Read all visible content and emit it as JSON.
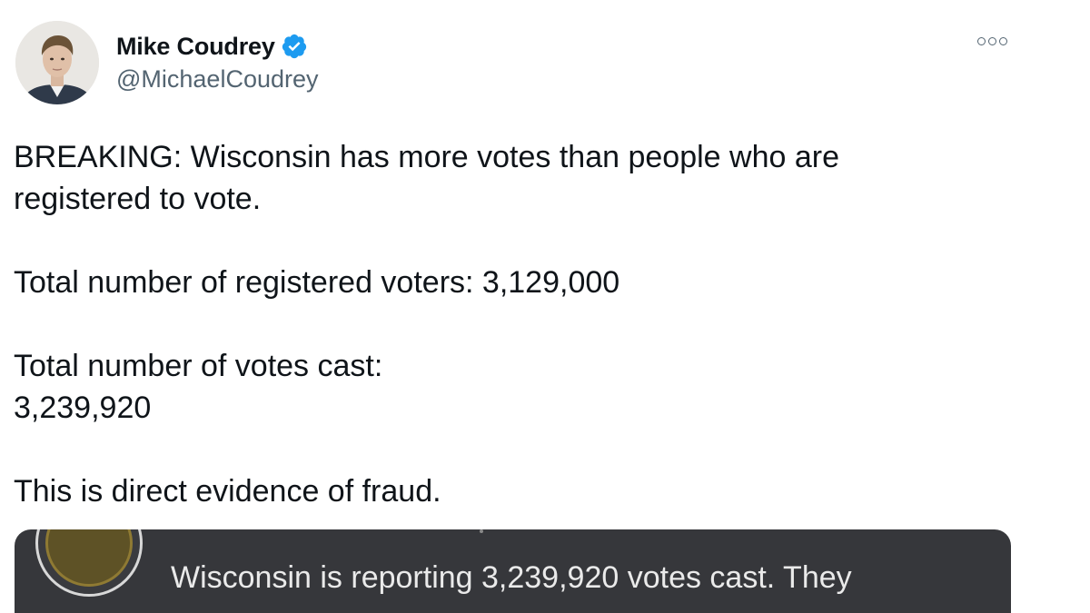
{
  "author": {
    "display_name": "Mike Coudrey",
    "handle": "@MichaelCoudrey",
    "verified": true
  },
  "icons": {
    "verified": "verified-badge-icon",
    "more": "more-options-icon"
  },
  "tweet": {
    "line1": "BREAKING: Wisconsin has more votes than people who are",
    "line2": "registered to vote.",
    "line3": "Total number of registered voters: 3,129,000",
    "line4": "Total number of votes cast:",
    "line5": "3,239,920",
    "line6": "This is direct evidence of fraud."
  },
  "embedded_card": {
    "text": "Wisconsin is reporting 3,239,920 votes cast. They"
  },
  "colors": {
    "verified_blue": "#1d9bf0",
    "card_bg": "#36373b",
    "handle_gray": "#536471"
  }
}
